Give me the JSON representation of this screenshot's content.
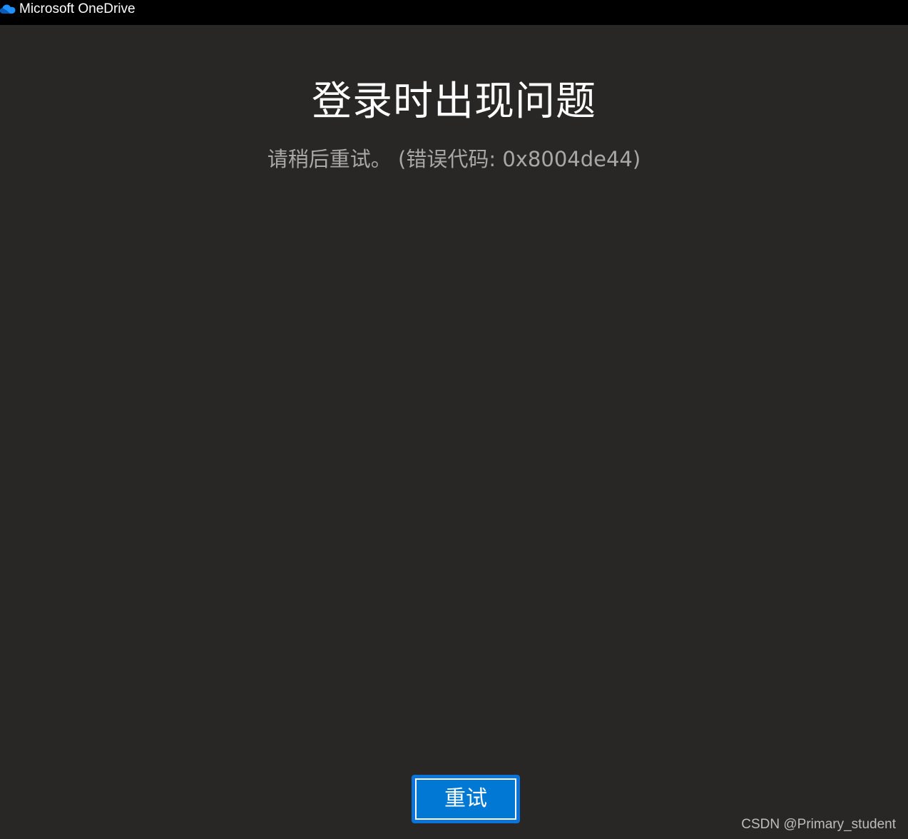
{
  "window": {
    "title": "Microsoft OneDrive",
    "icon": "onedrive-cloud-icon"
  },
  "main": {
    "heading": "登录时出现问题",
    "message": "请稍后重试。 (错误代码: 0x8004de44)",
    "retry_label": "重试"
  },
  "watermark": "CSDN @Primary_student",
  "colors": {
    "titlebar_bg": "#000000",
    "window_bg": "#282726",
    "accent": "#0078d4",
    "subtext": "#a8a8a8"
  }
}
